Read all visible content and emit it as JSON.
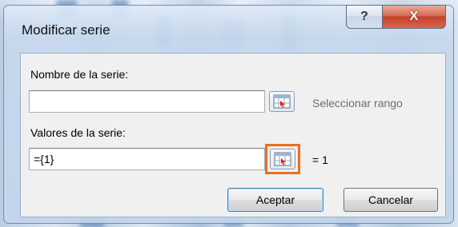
{
  "window": {
    "title": "Modificar serie",
    "help_glyph": "?",
    "close_glyph": "X"
  },
  "name_field": {
    "label": "Nombre de la serie:",
    "value": "",
    "range_button_icon": "range-select-icon",
    "hint": "Seleccionar rango",
    "hint_color": "#6d6d6d"
  },
  "values_field": {
    "label": "Valores de la serie:",
    "value": "={1}",
    "range_button_icon": "range-select-icon",
    "result": "= 1",
    "highlight_color": "#ec6f1d"
  },
  "buttons": {
    "ok": "Aceptar",
    "cancel": "Cancelar"
  }
}
